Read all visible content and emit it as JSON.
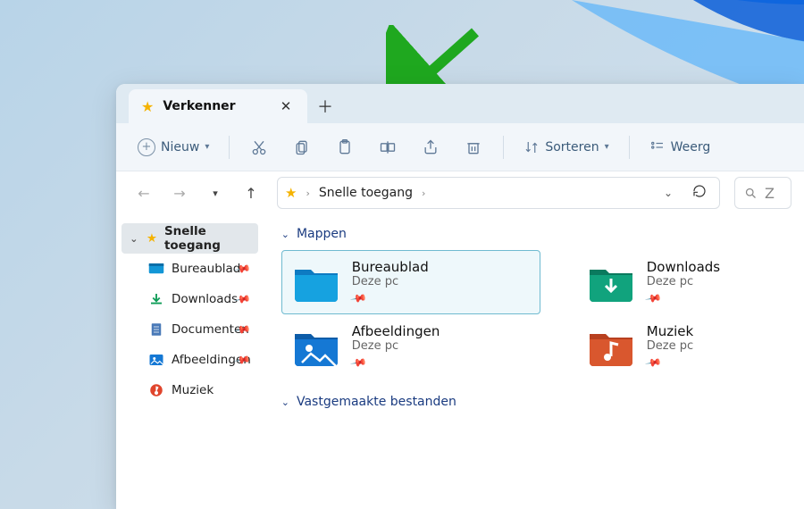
{
  "tab": {
    "title": "Verkenner"
  },
  "toolbar": {
    "new_label": "Nieuw",
    "sort_label": "Sorteren",
    "view_label": "Weerg"
  },
  "breadcrumb": {
    "root": "Snelle toegang"
  },
  "search": {
    "hint": "Z"
  },
  "sidebar": {
    "quick_access": "Snelle toegang",
    "items": [
      {
        "label": "Bureaublad"
      },
      {
        "label": "Downloads"
      },
      {
        "label": "Documenten"
      },
      {
        "label": "Afbeeldingen"
      },
      {
        "label": "Muziek"
      }
    ]
  },
  "sections": {
    "folders": "Mappen",
    "pinned": "Vastgemaakte bestanden"
  },
  "folders": [
    {
      "title": "Bureaublad",
      "sub": "Deze pc"
    },
    {
      "title": "Downloads",
      "sub": "Deze pc"
    },
    {
      "title": "Afbeeldingen",
      "sub": "Deze pc"
    },
    {
      "title": "Muziek",
      "sub": "Deze pc"
    }
  ]
}
